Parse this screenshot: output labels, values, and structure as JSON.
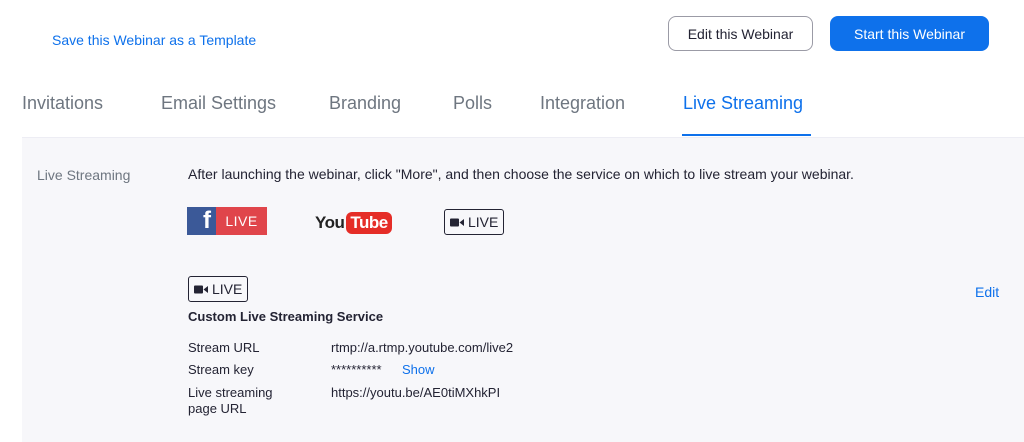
{
  "header": {
    "save_template_link": "Save this Webinar as a Template",
    "edit_button": "Edit this Webinar",
    "start_button": "Start this Webinar"
  },
  "tabs": [
    {
      "label": "Invitations",
      "active": false
    },
    {
      "label": "Email Settings",
      "active": false
    },
    {
      "label": "Branding",
      "active": false
    },
    {
      "label": "Polls",
      "active": false
    },
    {
      "label": "Integration",
      "active": false
    },
    {
      "label": "Live Streaming",
      "active": true
    }
  ],
  "live_streaming": {
    "section_label": "Live Streaming",
    "instructions": "After launching the webinar, click \"More\", and then choose the service on which to live stream your webinar.",
    "services": {
      "facebook": {
        "letter": "f",
        "badge": "LIVE"
      },
      "youtube": {
        "part1": "You",
        "part2": "Tube"
      },
      "custom": {
        "badge": "LIVE",
        "icon": "video-camera-icon"
      }
    },
    "configured": {
      "badge": "LIVE",
      "edit_link": "Edit",
      "service_name": "Custom Live Streaming Service",
      "stream_url_label": "Stream URL",
      "stream_url_value": "rtmp://a.rtmp.youtube.com/live2",
      "stream_key_label": "Stream key",
      "stream_key_value": "**********",
      "show_link": "Show",
      "page_url_label_line1": "Live streaming",
      "page_url_label_line2": "page URL",
      "page_url_value": "https://youtu.be/AE0tiMXhkPI"
    }
  },
  "colors": {
    "accent": "#0e71eb",
    "facebook_blue": "#3b5998",
    "facebook_live_red": "#e0454b",
    "youtube_red": "#e52d27",
    "section_background": "#f7f7fa"
  }
}
